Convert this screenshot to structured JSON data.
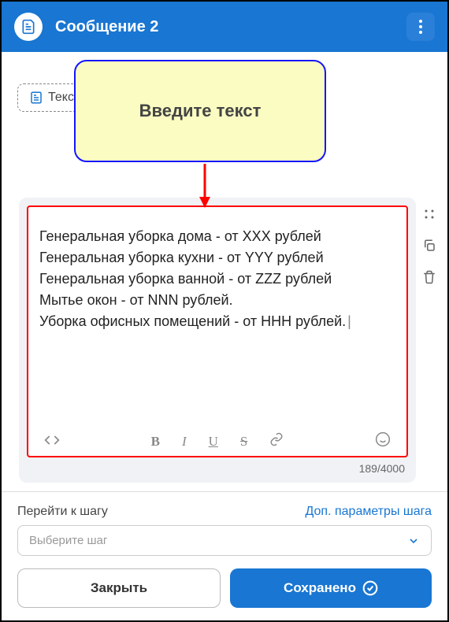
{
  "header": {
    "title": "Сообщение 2"
  },
  "chip": {
    "label": "Текст"
  },
  "callout": {
    "text": "Введите текст"
  },
  "editor": {
    "content": "Генеральная уборка дома - от ХХХ рублей\nГенеральная уборка кухни - от YYY рублей\nГенеральная уборка ванной - от ZZZ рублей\nМытье окон - от NNN рублей.\nУборка офисных помещений - от HHH рублей.",
    "counter": "189/4000"
  },
  "footer": {
    "step_label": "Перейти к шагу",
    "params_link": "Доп. параметры шага",
    "select_placeholder": "Выберите шаг",
    "close_btn": "Закрыть",
    "save_btn": "Сохранено"
  }
}
